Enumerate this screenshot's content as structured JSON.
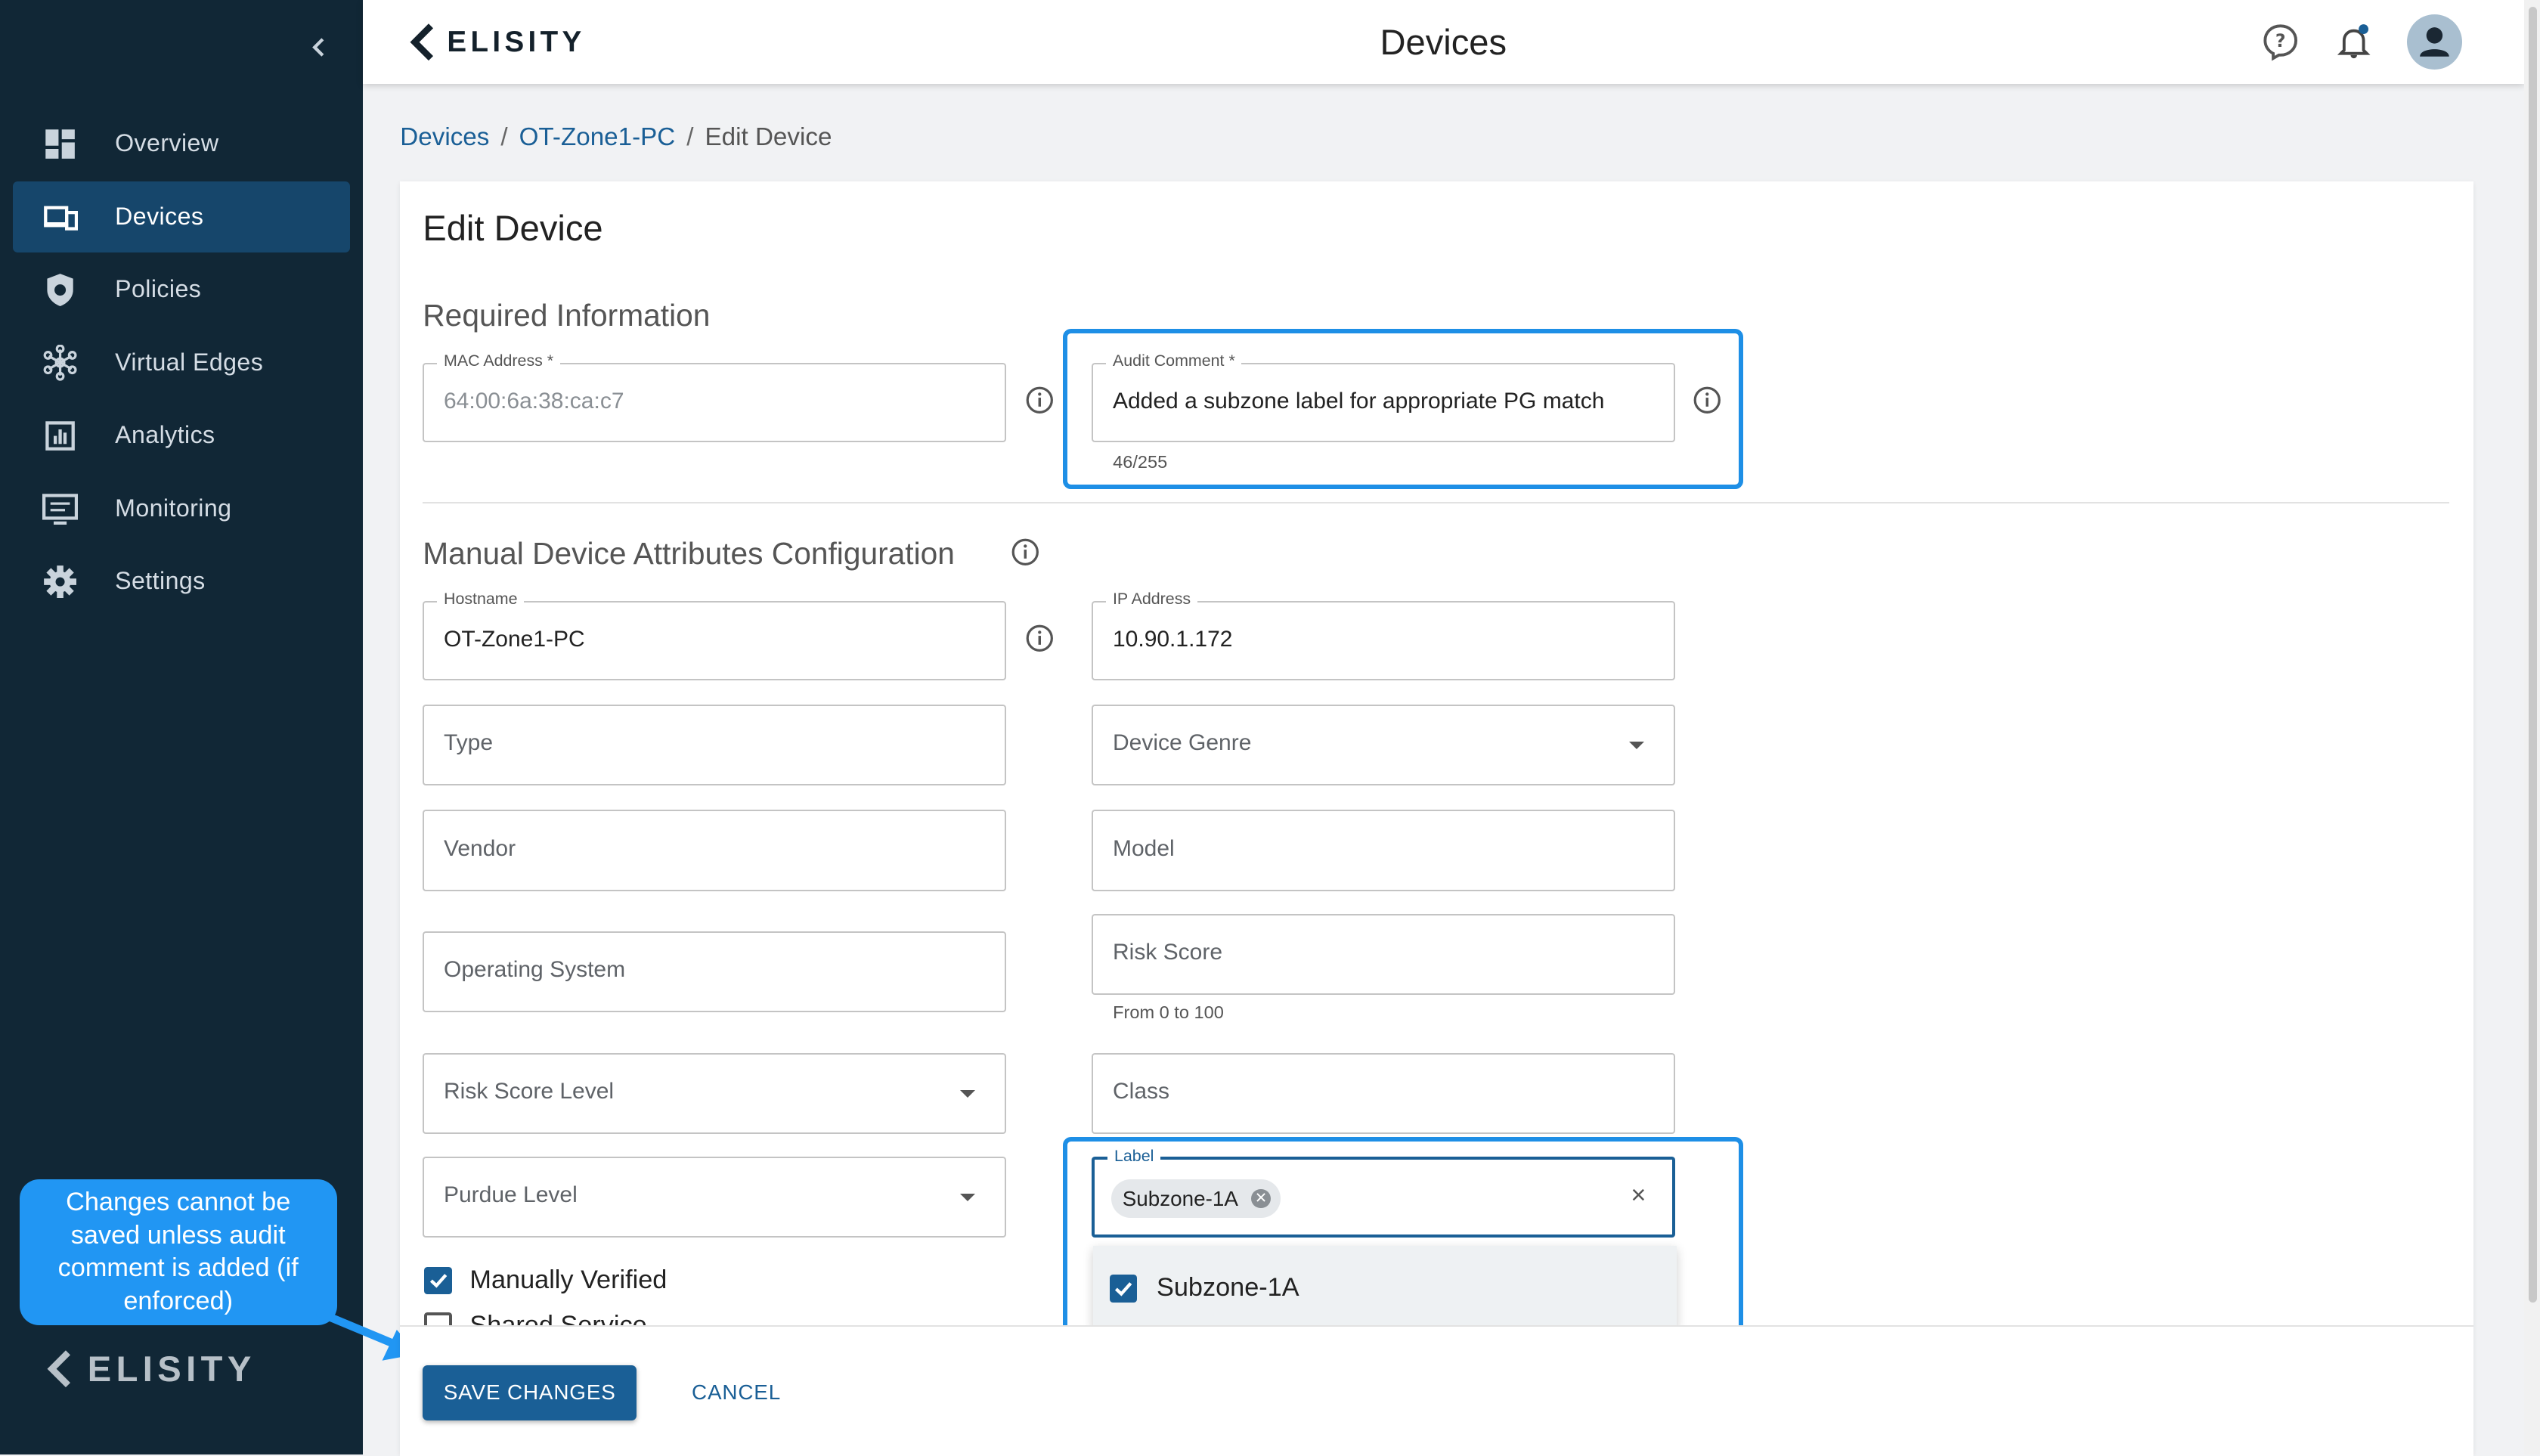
{
  "sidebar": {
    "items": [
      {
        "label": "Overview",
        "icon": "dashboard-icon"
      },
      {
        "label": "Devices",
        "icon": "devices-icon",
        "active": true
      },
      {
        "label": "Policies",
        "icon": "shield-icon"
      },
      {
        "label": "Virtual Edges",
        "icon": "network-nodes-icon"
      },
      {
        "label": "Analytics",
        "icon": "bar-chart-icon"
      },
      {
        "label": "Monitoring",
        "icon": "monitor-icon"
      },
      {
        "label": "Settings",
        "icon": "gear-icon"
      }
    ],
    "logo": "ELISITY"
  },
  "header": {
    "brand": "ELISITY",
    "title": "Devices"
  },
  "breadcrumb": {
    "items": [
      "Devices",
      "OT-Zone1-PC",
      "Edit Device"
    ],
    "separator": "/"
  },
  "form": {
    "title": "Edit Device",
    "required_section": "Required Information",
    "mac": {
      "label": "MAC Address *",
      "value": "64:00:6a:38:ca:c7"
    },
    "audit": {
      "label": "Audit Comment *",
      "value": "Added a subzone label for appropriate PG match",
      "counter": "46/255"
    },
    "manual_section": "Manual Device Attributes Configuration",
    "hostname": {
      "label": "Hostname",
      "value": "OT-Zone1-PC"
    },
    "ip": {
      "label": "IP Address",
      "value": "10.90.1.172"
    },
    "type_ph": "Type",
    "genre_ph": "Device Genre",
    "vendor_ph": "Vendor",
    "model_ph": "Model",
    "os_ph": "Operating System",
    "risk_score_ph": "Risk Score",
    "risk_score_helper": "From 0 to 100",
    "risk_level_ph": "Risk Score Level",
    "class_ph": "Class",
    "purdue_ph": "Purdue Level",
    "label": {
      "label": "Label",
      "chip": "Subzone-1A",
      "clear": "×"
    },
    "dropdown_option": "Subzone-1A",
    "manually_verified": "Manually Verified",
    "shared_service": "Shared Service"
  },
  "actions": {
    "save": "SAVE CHANGES",
    "cancel": "CANCEL"
  },
  "callout": {
    "text": "Changes cannot be saved unless audit comment is added (if enforced)"
  },
  "colors": {
    "sidebar_bg": "#112736",
    "active_nav": "#16466b",
    "primary": "#1a5f96",
    "highlight": "#1e8fe6",
    "callout": "#2196f3"
  }
}
